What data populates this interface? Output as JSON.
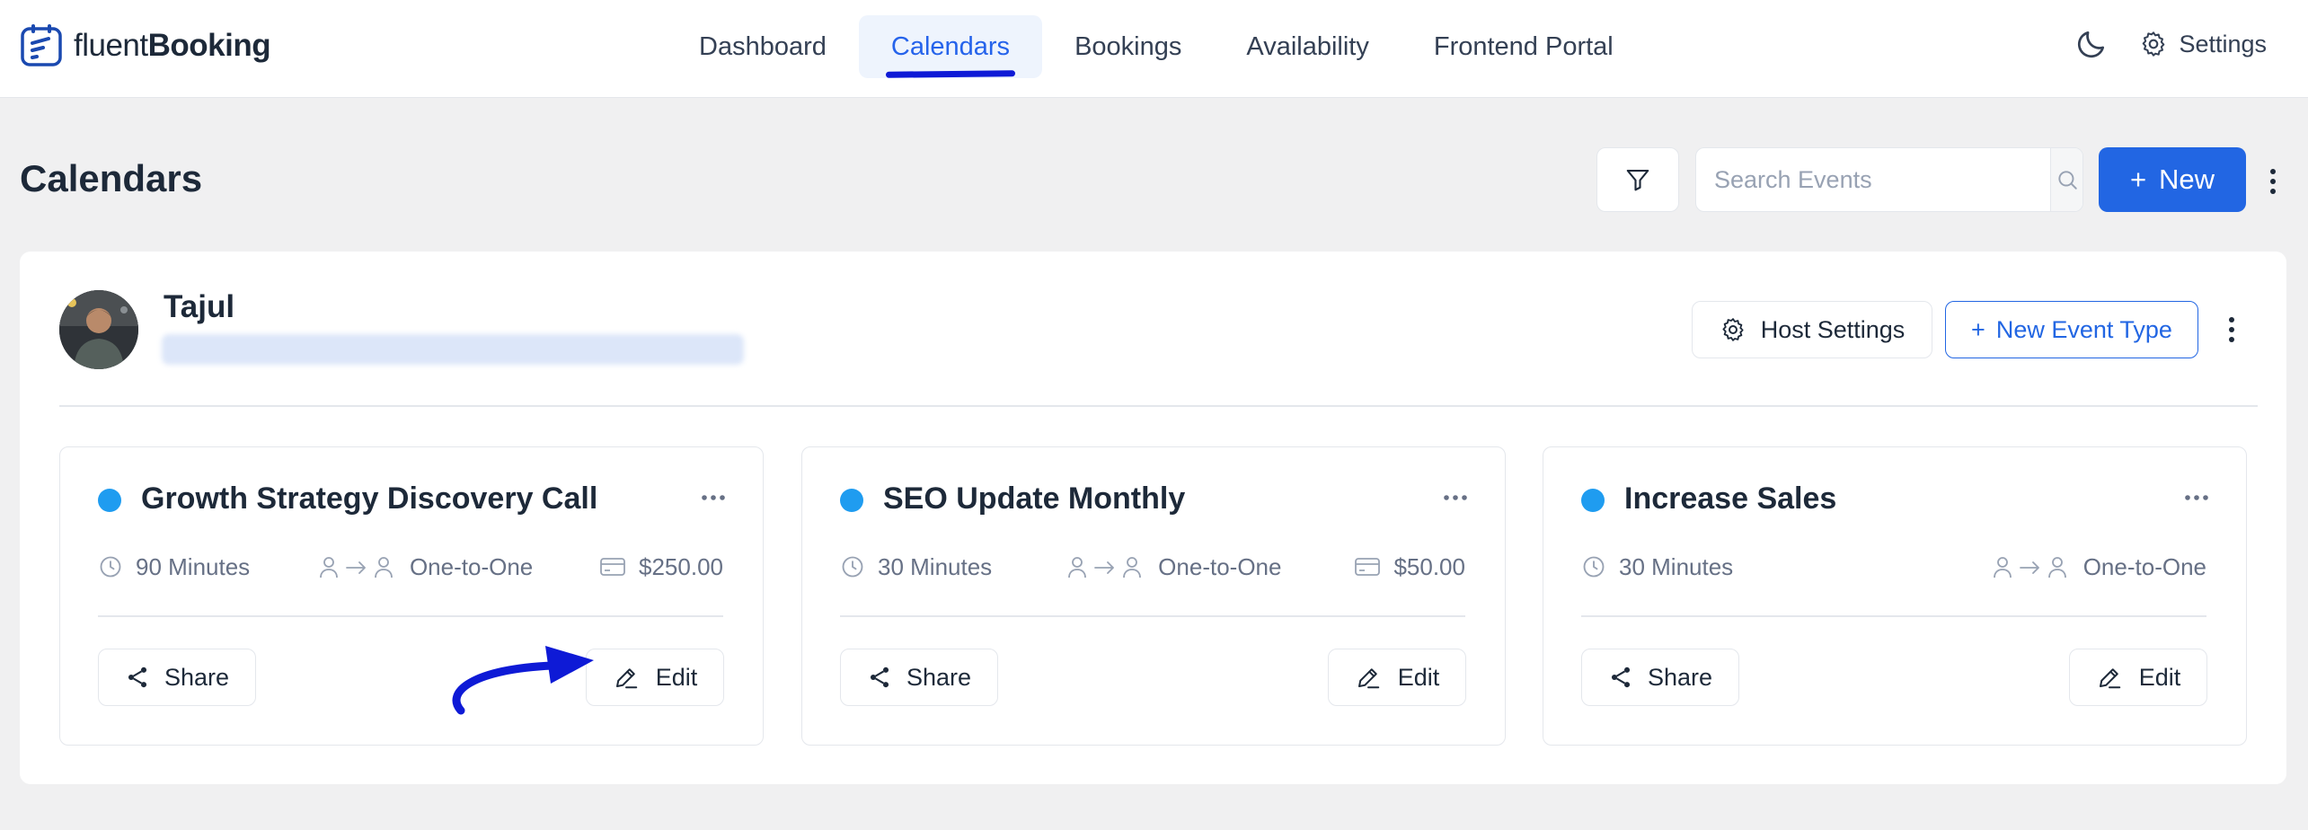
{
  "app": {
    "logo_light": "fluent",
    "logo_bold": "Booking"
  },
  "nav": {
    "items": [
      {
        "label": "Dashboard",
        "active": false
      },
      {
        "label": "Calendars",
        "active": true
      },
      {
        "label": "Bookings",
        "active": false
      },
      {
        "label": "Availability",
        "active": false
      },
      {
        "label": "Frontend Portal",
        "active": false
      }
    ],
    "settings_label": "Settings",
    "theme_icon": "moon-icon",
    "settings_icon": "gear-icon"
  },
  "header": {
    "title": "Calendars",
    "search_placeholder": "Search Events",
    "new_label": "New",
    "new_prefix": "+"
  },
  "host": {
    "name": "Tajul",
    "settings_label": "Host Settings",
    "new_event_type_label": "New Event Type",
    "new_event_type_prefix": "+"
  },
  "events": [
    {
      "title": "Growth Strategy Discovery Call",
      "duration": "90 Minutes",
      "type": "One-to-One",
      "price": "$250.00",
      "share_label": "Share",
      "edit_label": "Edit"
    },
    {
      "title": "SEO Update Monthly",
      "duration": "30 Minutes",
      "type": "One-to-One",
      "price": "$50.00",
      "share_label": "Share",
      "edit_label": "Edit"
    },
    {
      "title": "Increase Sales",
      "duration": "30 Minutes",
      "type": "One-to-One",
      "share_label": "Share",
      "edit_label": "Edit"
    }
  ],
  "colors": {
    "primary": "#2266e3",
    "active_nav_bg": "#eef4fd",
    "event_dot": "#1f9cf0",
    "annotation_arrow": "#0e1ad6",
    "page_bg": "#f0f0f1"
  }
}
